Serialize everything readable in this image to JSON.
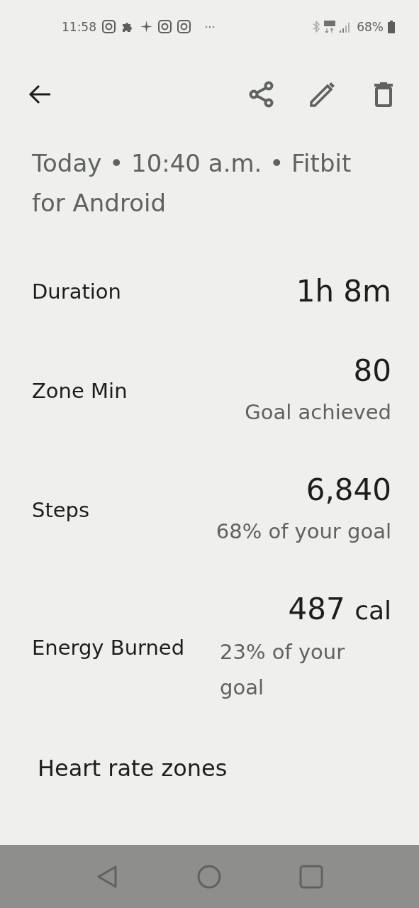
{
  "status_bar": {
    "time": "11:58",
    "notification_icons": [
      {
        "kind": "camera"
      },
      {
        "kind": "puzzle"
      },
      {
        "kind": "sparkle"
      },
      {
        "kind": "camera"
      },
      {
        "kind": "camera"
      },
      {
        "kind": "more"
      }
    ],
    "battery": "68%"
  },
  "subtitle": "Today • 10:40 a.m. • Fitbit for Android",
  "stats": [
    {
      "label": "Duration",
      "value": "1h 8m"
    },
    {
      "label": "Zone Min",
      "value": "80",
      "note": "Goal achieved"
    },
    {
      "label": "Steps",
      "value": "6,840",
      "note": "68% of your goal"
    },
    {
      "label": "Energy Burned",
      "value": "487",
      "unit": "cal",
      "note": "23% of your goal"
    }
  ],
  "section_title": "Heart rate zones"
}
